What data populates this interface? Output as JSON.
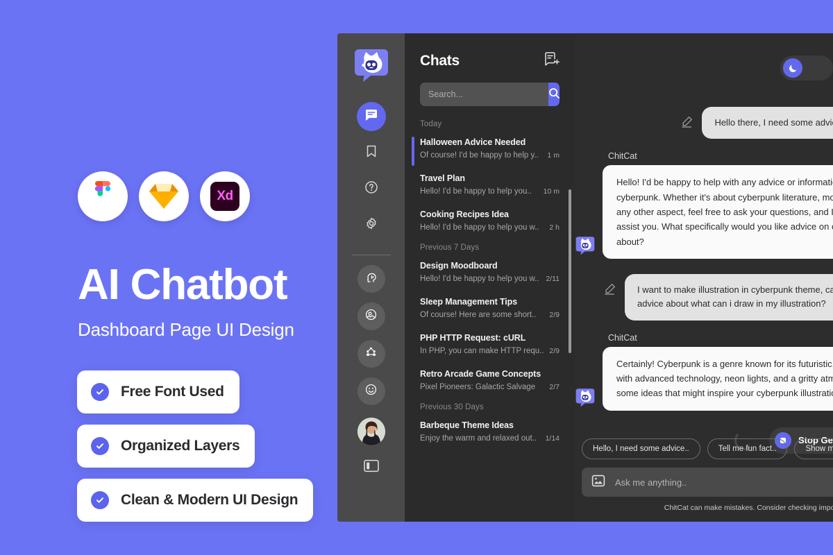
{
  "promo": {
    "title": "AI Chatbot",
    "subtitle": "Dashboard Page UI Design",
    "tools": [
      {
        "name": "figma-icon",
        "label": "Figma"
      },
      {
        "name": "sketch-icon",
        "label": "Sketch"
      },
      {
        "name": "adobe-xd-icon",
        "label": "Xd"
      }
    ],
    "features": [
      {
        "label": "Free Font Used"
      },
      {
        "label": "Organized Layers"
      },
      {
        "label": "Clean & Modern UI Design"
      }
    ],
    "background_color": "#6B73F5",
    "accent_color": "#5C63EF"
  },
  "rail": {
    "logo_name": "chitcat-logo",
    "nav": [
      {
        "name": "chats",
        "icon": "chat-bubble-icon",
        "active": true
      },
      {
        "name": "bookmarks",
        "icon": "bookmark-icon",
        "active": false
      },
      {
        "name": "help",
        "icon": "help-circle-icon",
        "active": false
      },
      {
        "name": "settings",
        "icon": "gear-icon",
        "active": false
      }
    ],
    "tools": [
      {
        "name": "ai-assistant",
        "icon": "head-brain-icon"
      },
      {
        "name": "ai-image",
        "icon": "image-ai-icon"
      },
      {
        "name": "ai-network",
        "icon": "network-nodes-icon"
      },
      {
        "name": "ai-emoji",
        "icon": "smiley-face-icon"
      }
    ],
    "avatar_name": "user-avatar",
    "panel_toggle_name": "panel-toggle-icon"
  },
  "chatlist": {
    "title": "Chats",
    "new_chat_icon": "new-chat-icon",
    "search": {
      "value": "",
      "placeholder": "Search..."
    },
    "groups": [
      {
        "label": "Today",
        "items": [
          {
            "title": "Halloween Advice Needed",
            "snippet": "Of course! I'd be happy to help y..",
            "time": "1 m",
            "active": true
          },
          {
            "title": "Travel Plan",
            "snippet": "Hello! I'd be happy to help you..",
            "time": "10 m",
            "active": false
          },
          {
            "title": "Cooking Recipes Idea",
            "snippet": "Hello! I'd be happy to help you w..",
            "time": "2 h",
            "active": false
          }
        ]
      },
      {
        "label": "Previous 7 Days",
        "items": [
          {
            "title": "Design Moodboard",
            "snippet": "Hello! I'd be happy to help you w..",
            "time": "2/11",
            "active": false
          },
          {
            "title": "Sleep Management Tips",
            "snippet": "Of course! Here are some short..",
            "time": "2/9",
            "active": false
          },
          {
            "title": "PHP HTTP Request: cURL",
            "snippet": "In PHP, you can make HTTP requ..",
            "time": "2/9",
            "active": false
          },
          {
            "title": "Retro Arcade Game Concepts",
            "snippet": "Pixel Pioneers: Galactic Salvage",
            "time": "2/7",
            "active": false
          }
        ]
      },
      {
        "label": "Previous 30 Days",
        "items": [
          {
            "title": "Barbeque Theme Ideas",
            "snippet": "Enjoy the warm and relaxed out..",
            "time": "1/14",
            "active": false
          }
        ]
      }
    ]
  },
  "chat": {
    "theme_toggle_icon": "moon-icon",
    "bot_name": "ChitCat",
    "messages": [
      {
        "role": "user",
        "text": "Hello there, I need some advice about cyberpunk"
      },
      {
        "role": "bot",
        "name": "ChitCat",
        "text": "Hello! I'd be happy to help with any advice or information you need about cyberpunk. Whether it's about cyberpunk literature, movies, games, or any other aspect, feel free to ask your questions, and I'll do my best to assist you. What specifically would you like advice on or information about?"
      },
      {
        "role": "user",
        "text": "I want to make illustration in cyberpunk theme, can you give me an advice about what can i draw in my illustration?"
      },
      {
        "role": "bot",
        "name": "ChitCat",
        "text": "Certainly! Cyberpunk is a genre known for its futuristic, dystopian settings with advanced technology, neon lights, and a gritty atmosphere. Here are some ideas that might inspire your cyberpunk illustration.."
      }
    ],
    "generating": {
      "stop_label": "Stop Generating",
      "spinner_name": "loading-spinner"
    },
    "suggestions": [
      "Hello, I need some advice..",
      "Tell me fun fact..",
      "Show me a code.."
    ],
    "composer": {
      "attach_icon": "image-attach-icon",
      "value": "",
      "placeholder": "Ask me anything.."
    },
    "disclaimer": "ChitCat can make mistakes. Consider checking important information.",
    "accent_color": "#6269F0",
    "panel_bg": "#2D2D2D"
  }
}
